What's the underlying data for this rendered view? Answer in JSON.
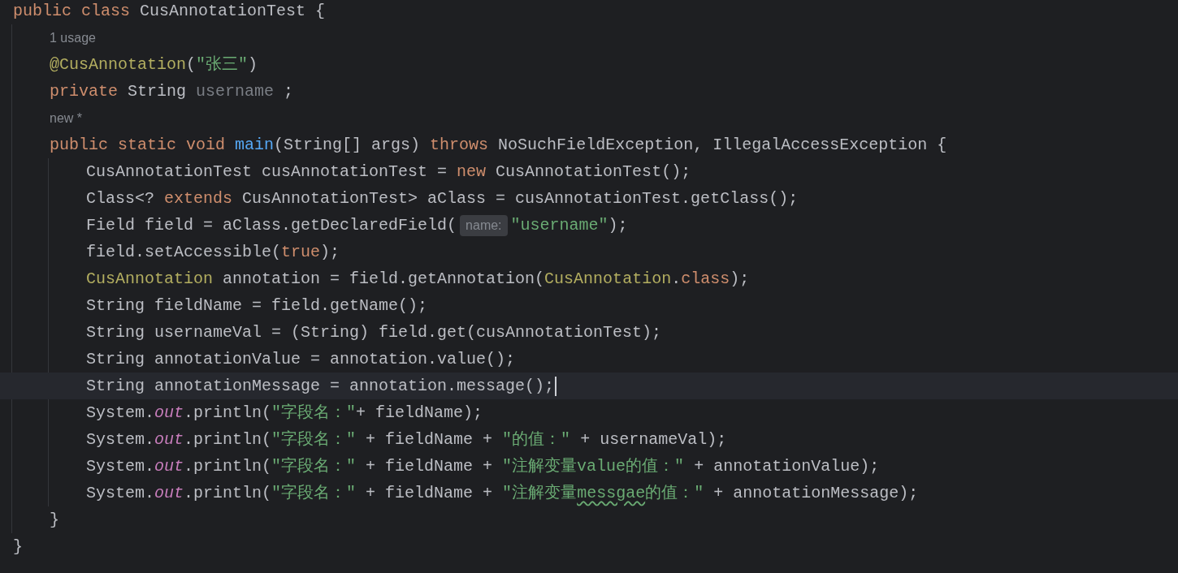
{
  "editor": {
    "lines": [
      {
        "kind": "code",
        "current": false,
        "tokens": [
          {
            "kind": "keyword",
            "text": "public class "
          },
          {
            "kind": "plain",
            "text": "CusAnnotationTest {"
          }
        ],
        "children": [
          {
            "kind": "hint",
            "tokens": [
              {
                "kind": "hint",
                "text": "1 usage"
              }
            ]
          },
          {
            "kind": "code",
            "current": false,
            "tokens": [
              {
                "kind": "annotation",
                "text": "@CusAnnotation"
              },
              {
                "kind": "plain",
                "text": "("
              },
              {
                "kind": "string",
                "text": "\"张三\""
              },
              {
                "kind": "plain",
                "text": ")"
              }
            ]
          },
          {
            "kind": "code",
            "current": false,
            "tokens": [
              {
                "kind": "keyword",
                "text": "private "
              },
              {
                "kind": "plain",
                "text": "String "
              },
              {
                "kind": "unused",
                "text": "username"
              },
              {
                "kind": "plain",
                "text": " ;"
              }
            ]
          },
          {
            "kind": "hint",
            "tokens": [
              {
                "kind": "hint",
                "text": "new *"
              }
            ]
          },
          {
            "kind": "code",
            "current": false,
            "tokens": [
              {
                "kind": "keyword",
                "text": "public static void "
              },
              {
                "kind": "declaration",
                "text": "main"
              },
              {
                "kind": "plain",
                "text": "(String[] args) "
              },
              {
                "kind": "keyword",
                "text": "throws "
              },
              {
                "kind": "plain",
                "text": "NoSuchFieldException, IllegalAccessException {"
              }
            ],
            "children": [
              {
                "kind": "code",
                "current": false,
                "tokens": [
                  {
                    "kind": "plain",
                    "text": "CusAnnotationTest cusAnnotationTest = "
                  },
                  {
                    "kind": "keyword",
                    "text": "new "
                  },
                  {
                    "kind": "plain",
                    "text": "CusAnnotationTest();"
                  }
                ]
              },
              {
                "kind": "code",
                "current": false,
                "tokens": [
                  {
                    "kind": "plain",
                    "text": "Class<? "
                  },
                  {
                    "kind": "keyword",
                    "text": "extends "
                  },
                  {
                    "kind": "plain",
                    "text": "CusAnnotationTest> aClass = cusAnnotationTest.getClass();"
                  }
                ]
              },
              {
                "kind": "code",
                "current": false,
                "tokens": [
                  {
                    "kind": "plain",
                    "text": "Field field = aClass.getDeclaredField("
                  },
                  {
                    "kind": "inlay",
                    "text": "name:"
                  },
                  {
                    "kind": "string",
                    "text": "\"username\""
                  },
                  {
                    "kind": "plain",
                    "text": ");"
                  }
                ]
              },
              {
                "kind": "code",
                "current": false,
                "tokens": [
                  {
                    "kind": "plain",
                    "text": "field.setAccessible("
                  },
                  {
                    "kind": "keyword",
                    "text": "true"
                  },
                  {
                    "kind": "plain",
                    "text": ");"
                  }
                ]
              },
              {
                "kind": "code",
                "current": false,
                "tokens": [
                  {
                    "kind": "annotation",
                    "text": "CusAnnotation "
                  },
                  {
                    "kind": "plain",
                    "text": "annotation = field.getAnnotation("
                  },
                  {
                    "kind": "annotation",
                    "text": "CusAnnotation"
                  },
                  {
                    "kind": "plain",
                    "text": "."
                  },
                  {
                    "kind": "keyword",
                    "text": "class"
                  },
                  {
                    "kind": "plain",
                    "text": ");"
                  }
                ]
              },
              {
                "kind": "code",
                "current": false,
                "tokens": [
                  {
                    "kind": "plain",
                    "text": "String fieldName = field.getName();"
                  }
                ]
              },
              {
                "kind": "code",
                "current": false,
                "tokens": [
                  {
                    "kind": "plain",
                    "text": "String usernameVal = (String) field.get(cusAnnotationTest);"
                  }
                ]
              },
              {
                "kind": "code",
                "current": false,
                "tokens": [
                  {
                    "kind": "plain",
                    "text": "String annotationValue = annotation.value();"
                  }
                ]
              },
              {
                "kind": "code",
                "current": true,
                "tokens": [
                  {
                    "kind": "plain",
                    "text": "String annotationMessage = annotation.message();"
                  }
                ]
              },
              {
                "kind": "code",
                "current": false,
                "tokens": [
                  {
                    "kind": "plain",
                    "text": "System."
                  },
                  {
                    "kind": "static",
                    "text": "out"
                  },
                  {
                    "kind": "plain",
                    "text": ".println("
                  },
                  {
                    "kind": "string",
                    "text": "\"字段名：\""
                  },
                  {
                    "kind": "plain",
                    "text": "+ fieldName);"
                  }
                ]
              },
              {
                "kind": "code",
                "current": false,
                "tokens": [
                  {
                    "kind": "plain",
                    "text": "System."
                  },
                  {
                    "kind": "static",
                    "text": "out"
                  },
                  {
                    "kind": "plain",
                    "text": ".println("
                  },
                  {
                    "kind": "string",
                    "text": "\"字段名：\""
                  },
                  {
                    "kind": "plain",
                    "text": " + fieldName + "
                  },
                  {
                    "kind": "string",
                    "text": "\"的值：\""
                  },
                  {
                    "kind": "plain",
                    "text": " + usernameVal);"
                  }
                ]
              },
              {
                "kind": "code",
                "current": false,
                "tokens": [
                  {
                    "kind": "plain",
                    "text": "System."
                  },
                  {
                    "kind": "static",
                    "text": "out"
                  },
                  {
                    "kind": "plain",
                    "text": ".println("
                  },
                  {
                    "kind": "string",
                    "text": "\"字段名：\""
                  },
                  {
                    "kind": "plain",
                    "text": " + fieldName + "
                  },
                  {
                    "kind": "string",
                    "text": "\"注解变量value的值：\""
                  },
                  {
                    "kind": "plain",
                    "text": " + annotationValue);"
                  }
                ]
              },
              {
                "kind": "code",
                "current": false,
                "tokens": [
                  {
                    "kind": "plain",
                    "text": "System."
                  },
                  {
                    "kind": "static",
                    "text": "out"
                  },
                  {
                    "kind": "plain",
                    "text": ".println("
                  },
                  {
                    "kind": "string",
                    "text": "\"字段名：\""
                  },
                  {
                    "kind": "plain",
                    "text": " + fieldName + "
                  },
                  {
                    "kind": "string",
                    "text": "\"注解变量"
                  },
                  {
                    "kind": "typo",
                    "text": "messgae"
                  },
                  {
                    "kind": "string",
                    "text": "的值：\""
                  },
                  {
                    "kind": "plain",
                    "text": " + annotationMessage);"
                  }
                ]
              }
            ]
          },
          {
            "kind": "code",
            "current": false,
            "tokens": [
              {
                "kind": "plain",
                "text": "}"
              }
            ]
          }
        ]
      },
      {
        "kind": "code",
        "current": false,
        "tokens": [
          {
            "kind": "plain",
            "text": "}"
          }
        ]
      }
    ]
  }
}
